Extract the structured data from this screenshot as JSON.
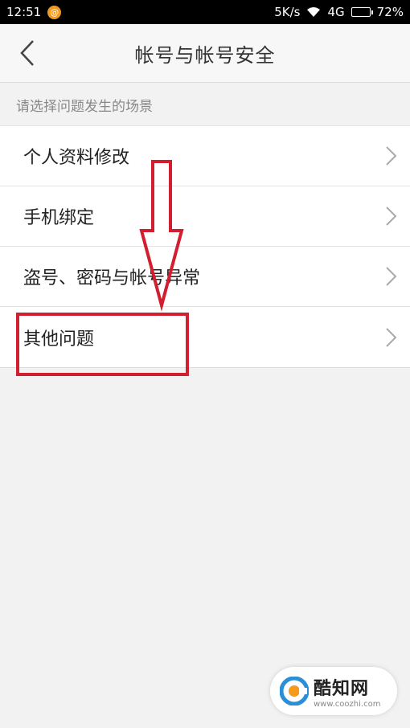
{
  "status_bar": {
    "time": "12:51",
    "notification_icon": "at-sign-icon",
    "speed": "5K/s",
    "network": "4G",
    "battery": "72%",
    "battery_level": 0.72
  },
  "header": {
    "title": "帐号与帐号安全",
    "back_icon": "chevron-left-icon"
  },
  "section_hint": "请选择问题发生的场景",
  "items": [
    {
      "label": "个人资料修改"
    },
    {
      "label": "手机绑定"
    },
    {
      "label": "盗号、密码与帐号异常"
    },
    {
      "label": "其他问题"
    }
  ],
  "annotation": {
    "color": "#d11f2f"
  },
  "watermark": {
    "name": "酷知网",
    "url": "www.coozhi.com"
  }
}
